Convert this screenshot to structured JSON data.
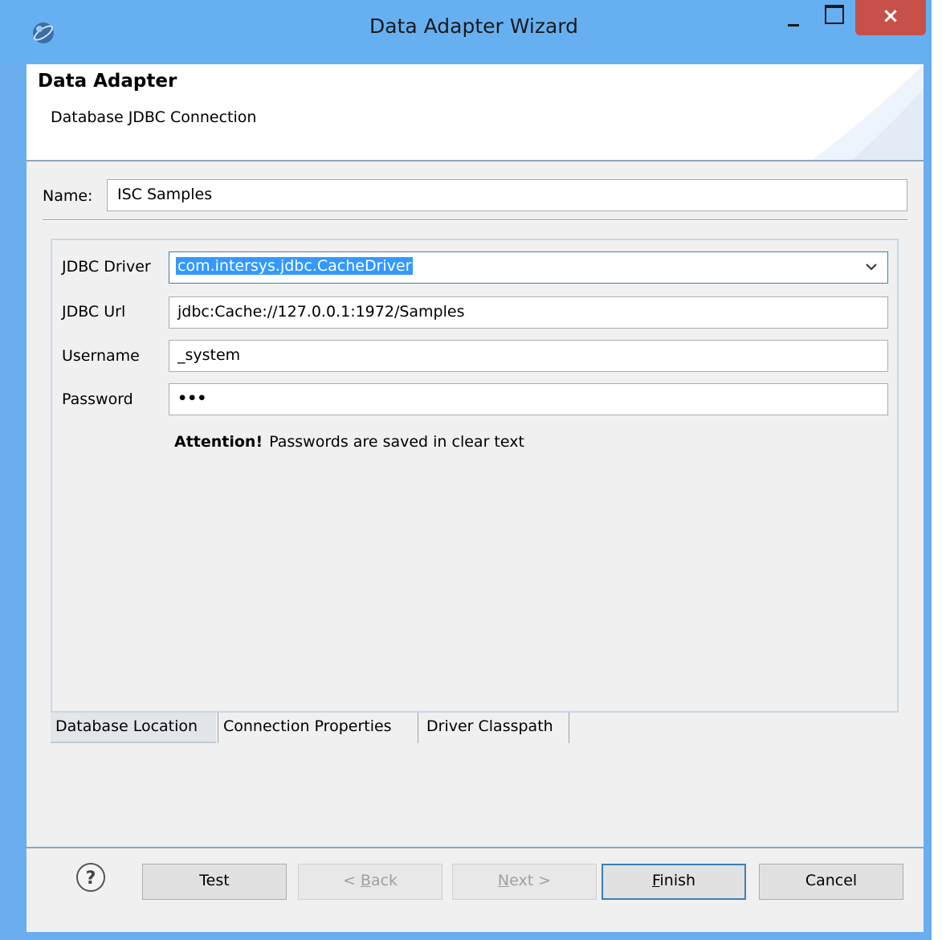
{
  "window": {
    "title": "Data Adapter Wizard",
    "close_glyph": "×"
  },
  "header": {
    "title": "Data Adapter",
    "subtitle": "Database JDBC Connection"
  },
  "name_field": {
    "label": "Name:",
    "value": "ISC Samples"
  },
  "connection": {
    "driver_label": "JDBC Driver",
    "driver_value": "com.intersys.jdbc.CacheDriver",
    "url_label": "JDBC Url",
    "url_value": "jdbc:Cache://127.0.0.1:1972/Samples",
    "username_label": "Username",
    "username_value": "_system",
    "password_label": "Password",
    "password_value": "•••",
    "attention_strong": "Attention!",
    "attention_text": "Passwords are saved in clear text"
  },
  "tabs": [
    {
      "label": "Database Location",
      "selected": true
    },
    {
      "label": "Connection Properties",
      "selected": false
    },
    {
      "label": "Driver Classpath",
      "selected": false
    }
  ],
  "footer": {
    "help_icon": "help-icon",
    "test_label": "Test",
    "back_prefix": "< ",
    "back_mnemonic": "B",
    "back_rest": "ack",
    "next_mnemonic": "N",
    "next_rest": "ext >",
    "finish_mnemonic": "F",
    "finish_rest": "inish",
    "cancel_label": "Cancel"
  },
  "colors": {
    "titlebar": "#66b0f2",
    "close_button": "#c7504a",
    "selection": "#3399ff"
  }
}
